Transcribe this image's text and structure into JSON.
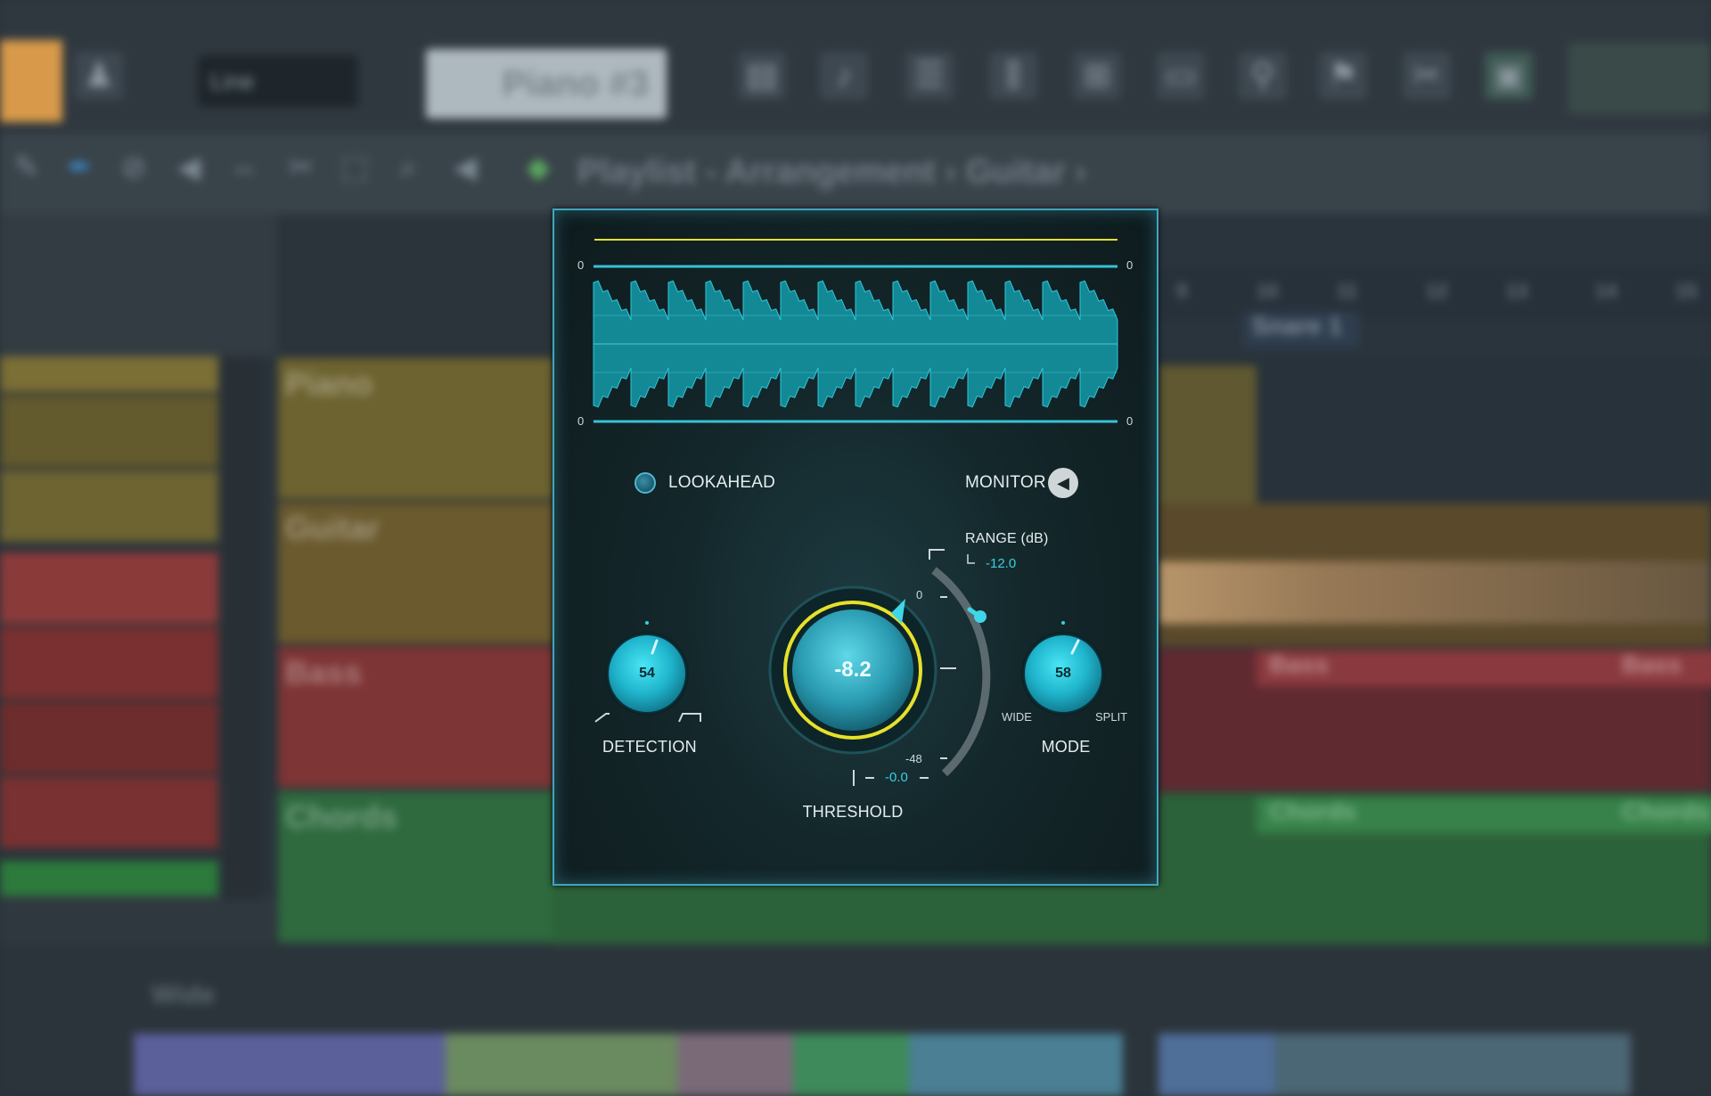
{
  "background": {
    "breadcrumb": "Playlist - Arrangement › Guitar ›",
    "pattern_name": "Piano #3",
    "line_select": "Line",
    "tracks": [
      {
        "name": "Piano",
        "color": "#6d6330"
      },
      {
        "name": "Guitar",
        "color": "#6b5a2e"
      },
      {
        "name": "Bass",
        "color": "#7e3535"
      },
      {
        "name": "Chords",
        "color": "#2e6a3e"
      }
    ],
    "ruler_numbers": [
      "9",
      "10",
      "11",
      "12",
      "13",
      "14",
      "15"
    ],
    "clips": {
      "bass_1": "Bass",
      "bass_2": "Bass",
      "chords_1": "Chords",
      "chords_2": "Chords",
      "snare": "Snare 1"
    },
    "bottom_left": "Wide"
  },
  "plugin": {
    "waveform": {
      "top_left_label": "0",
      "top_right_label": "0",
      "bottom_left_label": "0",
      "bottom_right_label": "0",
      "accent_color": "#37c2d6"
    },
    "lookahead_label": "LOOKAHEAD",
    "monitor_label": "MONITOR",
    "detection": {
      "label": "DETECTION",
      "value": "54"
    },
    "threshold": {
      "label": "THRESHOLD",
      "value": "-8.2",
      "scale_top": "0",
      "scale_bottom": "-48",
      "readout": "-0.0",
      "ring_color": "#f2e31b"
    },
    "range": {
      "label": "RANGE (dB)",
      "value": "-12.0"
    },
    "mode": {
      "label": "MODE",
      "value": "58",
      "left_label": "WIDE",
      "right_label": "SPLIT"
    }
  }
}
